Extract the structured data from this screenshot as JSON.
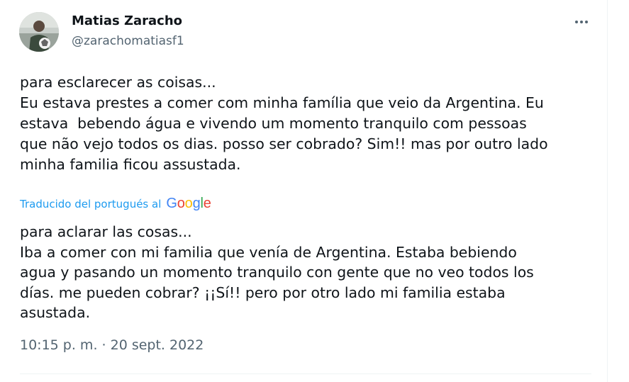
{
  "author": {
    "name": "Matias Zaracho",
    "handle": "@zarachomatiasf1"
  },
  "tweet": {
    "lines": [
      "para esclarecer as coisas...",
      "Eu estava prestes a comer com minha família que veio da Argentina. Eu",
      "estava  bebendo água e vivendo um momento tranquilo com pessoas",
      "que não vejo todos os dias. posso ser cobrado? Sim!! mas por outro lado",
      "minha familia ficou assustada."
    ]
  },
  "translation": {
    "label": "Traducido del portugués al",
    "provider": "Google",
    "lines": [
      "para aclarar las cosas...",
      "Iba a comer con mi familia que venía de Argentina. Estaba bebiendo",
      "agua y pasando un momento tranquilo con gente que no veo todos los",
      "días. me pueden cobrar? ¡¡Sí!! pero por otro lado mi familia estaba",
      "asustada."
    ]
  },
  "meta": {
    "time": "10:15 p. m.",
    "separator": " · ",
    "date": "20 sept. 2022"
  },
  "icons": {
    "more": "more-horizontal-icon",
    "avatar": "profile-photo"
  },
  "colors": {
    "text": "#0f1419",
    "secondary": "#536471",
    "link": "#1d9bf0",
    "google_blue": "#4285f4",
    "google_red": "#ea4335",
    "google_yellow": "#fbbc05",
    "google_green": "#34a853"
  }
}
